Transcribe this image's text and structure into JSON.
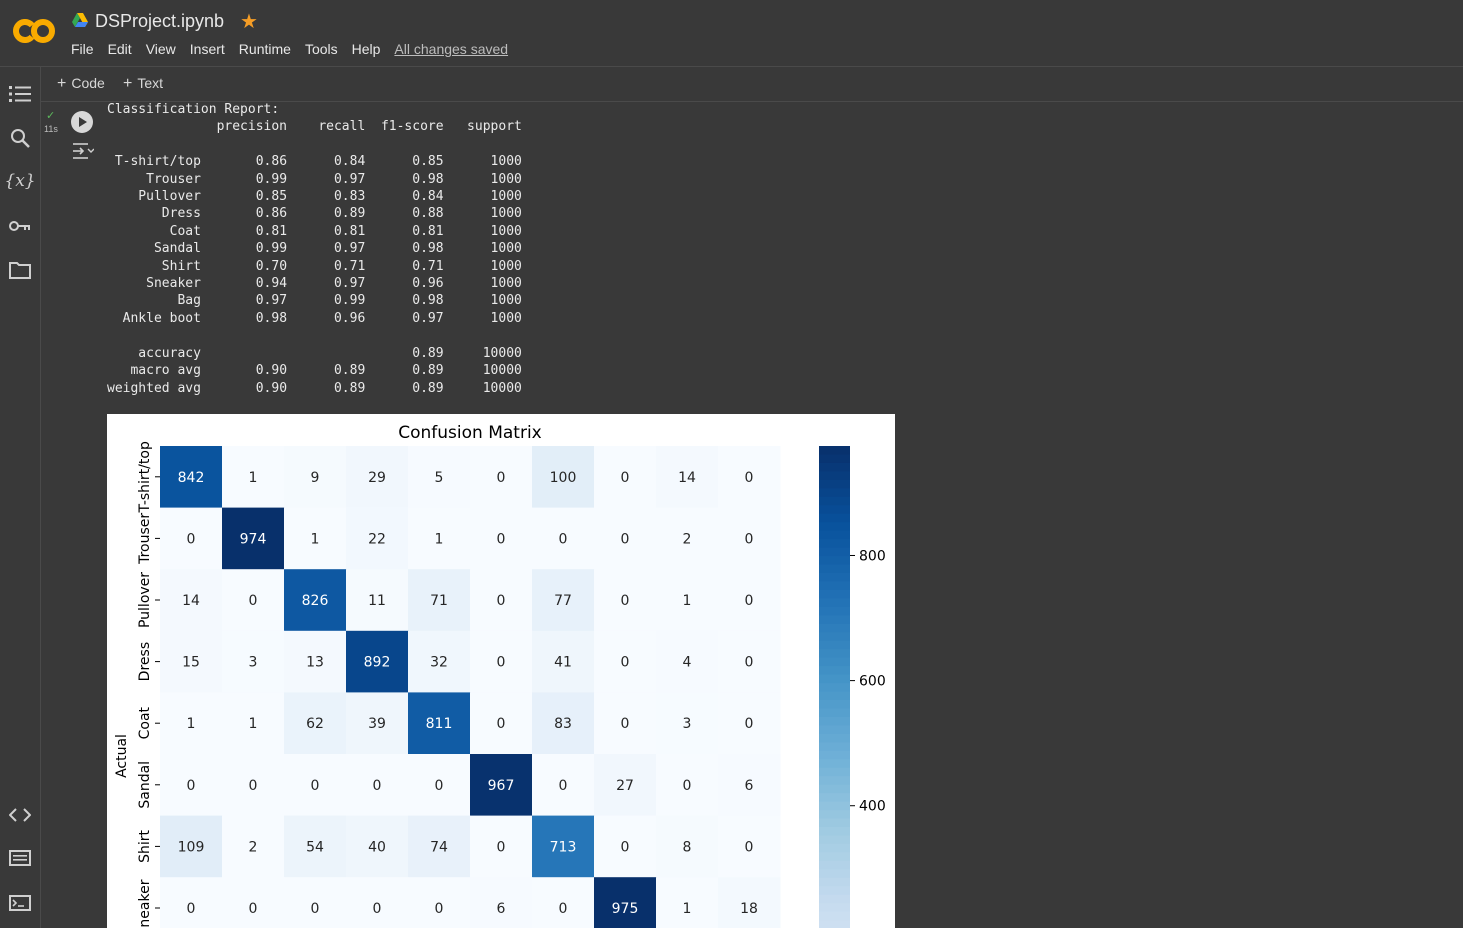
{
  "header": {
    "notebook_title": "DSProject.ipynb",
    "menu": [
      "File",
      "Edit",
      "View",
      "Insert",
      "Runtime",
      "Tools",
      "Help"
    ],
    "save_status": "All changes saved"
  },
  "toolbar": {
    "code_label": "Code",
    "text_label": "Text"
  },
  "cell": {
    "exec_time": "11s"
  },
  "sidebar": {
    "icons": [
      "table-of-contents-icon",
      "search-icon",
      "variables-icon",
      "secrets-key-icon",
      "files-folder-icon",
      "code-snippets-icon",
      "command-palette-icon",
      "terminal-icon"
    ]
  },
  "report": {
    "title": "Classification Report:",
    "headers": [
      "precision",
      "recall",
      "f1-score",
      "support"
    ],
    "rows": [
      {
        "label": "T-shirt/top",
        "precision": "0.86",
        "recall": "0.84",
        "f1": "0.85",
        "support": "1000"
      },
      {
        "label": "Trouser",
        "precision": "0.99",
        "recall": "0.97",
        "f1": "0.98",
        "support": "1000"
      },
      {
        "label": "Pullover",
        "precision": "0.85",
        "recall": "0.83",
        "f1": "0.84",
        "support": "1000"
      },
      {
        "label": "Dress",
        "precision": "0.86",
        "recall": "0.89",
        "f1": "0.88",
        "support": "1000"
      },
      {
        "label": "Coat",
        "precision": "0.81",
        "recall": "0.81",
        "f1": "0.81",
        "support": "1000"
      },
      {
        "label": "Sandal",
        "precision": "0.99",
        "recall": "0.97",
        "f1": "0.98",
        "support": "1000"
      },
      {
        "label": "Shirt",
        "precision": "0.70",
        "recall": "0.71",
        "f1": "0.71",
        "support": "1000"
      },
      {
        "label": "Sneaker",
        "precision": "0.94",
        "recall": "0.97",
        "f1": "0.96",
        "support": "1000"
      },
      {
        "label": "Bag",
        "precision": "0.97",
        "recall": "0.99",
        "f1": "0.98",
        "support": "1000"
      },
      {
        "label": "Ankle boot",
        "precision": "0.98",
        "recall": "0.96",
        "f1": "0.97",
        "support": "1000"
      }
    ],
    "summary": [
      {
        "label": "accuracy",
        "precision": "",
        "recall": "",
        "f1": "0.89",
        "support": "10000"
      },
      {
        "label": "macro avg",
        "precision": "0.90",
        "recall": "0.89",
        "f1": "0.89",
        "support": "10000"
      },
      {
        "label": "weighted avg",
        "precision": "0.90",
        "recall": "0.89",
        "f1": "0.89",
        "support": "10000"
      }
    ]
  },
  "chart_data": {
    "type": "heatmap",
    "title": "Confusion Matrix",
    "ylabel": "Actual",
    "colormap": "Blues",
    "y_tick_labels": [
      "T-shirt/top",
      "Trouser",
      "Pullover",
      "Dress",
      "Coat",
      "Sandal",
      "Shirt",
      "Sneaker"
    ],
    "rows": [
      [
        842,
        1,
        9,
        29,
        5,
        0,
        100,
        0,
        14,
        0
      ],
      [
        0,
        974,
        1,
        22,
        1,
        0,
        0,
        0,
        2,
        0
      ],
      [
        14,
        0,
        826,
        11,
        71,
        0,
        77,
        0,
        1,
        0
      ],
      [
        15,
        3,
        13,
        892,
        32,
        0,
        41,
        0,
        4,
        0
      ],
      [
        1,
        1,
        62,
        39,
        811,
        0,
        83,
        0,
        3,
        0
      ],
      [
        0,
        0,
        0,
        0,
        0,
        967,
        0,
        27,
        0,
        6
      ],
      [
        109,
        2,
        54,
        40,
        74,
        0,
        713,
        0,
        8,
        0
      ],
      [
        0,
        0,
        0,
        0,
        0,
        6,
        0,
        975,
        1,
        18
      ]
    ],
    "colorbar_ticks": [
      800,
      600,
      400
    ],
    "vmin": 0,
    "vmax": 975
  }
}
